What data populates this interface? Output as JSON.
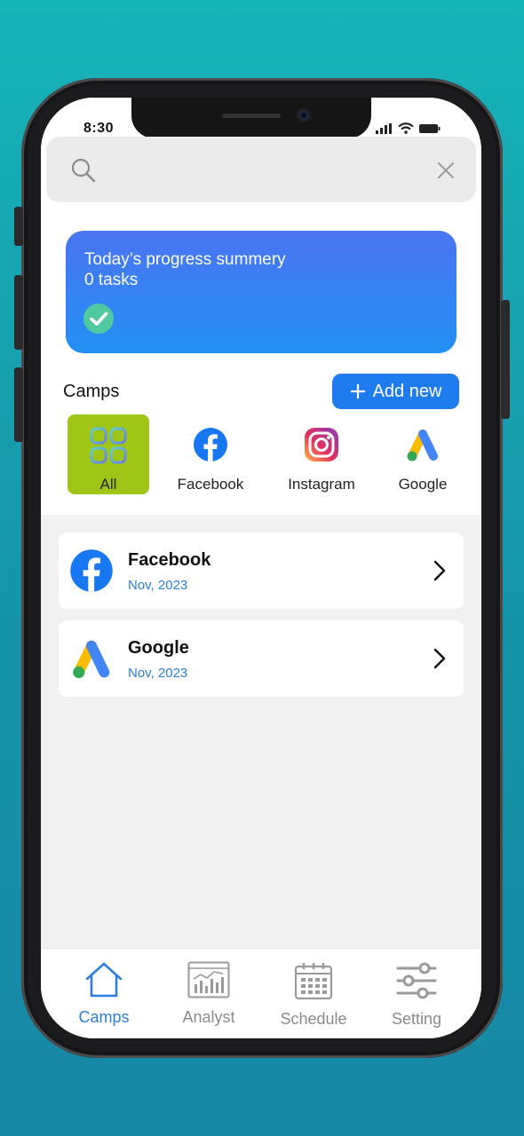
{
  "status": {
    "time": "8:30"
  },
  "search": {
    "placeholder": ""
  },
  "progress": {
    "title": "Today’s progress summery",
    "tasks": "0 tasks"
  },
  "camps": {
    "title": "Camps",
    "add_label": "Add new",
    "categories": [
      {
        "label": "All",
        "icon": "grid-icon"
      },
      {
        "label": "Facebook",
        "icon": "facebook-icon"
      },
      {
        "label": "Instagram",
        "icon": "instagram-icon"
      },
      {
        "label": "Google",
        "icon": "google-ads-icon"
      }
    ]
  },
  "list": [
    {
      "name": "Facebook",
      "date": "Nov, 2023"
    },
    {
      "name": "Google",
      "date": "Nov, 2023"
    }
  ],
  "tabs": [
    {
      "label": "Camps",
      "icon": "home-icon",
      "active": true
    },
    {
      "label": "Analyst",
      "icon": "analytics-icon",
      "active": false
    },
    {
      "label": "Schedule",
      "icon": "calendar-icon",
      "active": false
    },
    {
      "label": "Setting",
      "icon": "sliders-icon",
      "active": false
    }
  ],
  "colors": {
    "accent": "#1f7cf0",
    "all_chip": "#9fc516",
    "background": "#17b4b8"
  }
}
